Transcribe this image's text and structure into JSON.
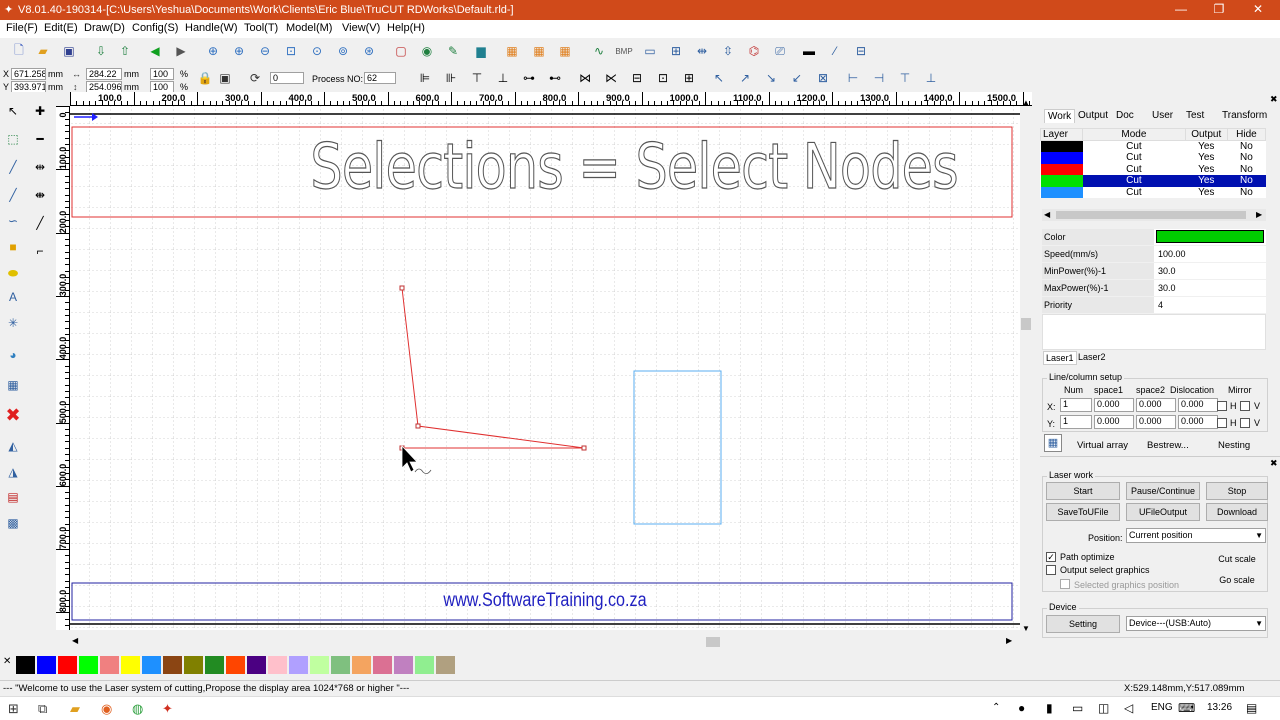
{
  "window": {
    "title": "V8.01.40-190314-[C:\\Users\\Yeshua\\Documents\\Work\\Clients\\Eric Blue\\TruCUT RDWorks\\Default.rld-]",
    "minimize": "—",
    "maximize": "❐",
    "close": "✕"
  },
  "menu": [
    "File(F)",
    "Edit(E)",
    "Draw(D)",
    "Config(S)",
    "Handle(W)",
    "Tool(T)",
    "Model(M)",
    "View(V)",
    "Help(H)"
  ],
  "coords": {
    "x_label": "X",
    "x_value": "671.258",
    "x_unit": "mm",
    "y_label": "Y",
    "y_value": "393.971",
    "y_unit": "mm",
    "w_value": "284.22",
    "w_unit": "mm",
    "h_value": "254.096",
    "h_unit": "mm",
    "sx_value": "100",
    "sy_value": "100",
    "pct1": "%",
    "pct2": "%",
    "rotate_value": "0",
    "process_label": "Process NO:",
    "process_value": "62"
  },
  "ruler": {
    "h_labels": [
      "100.0",
      "200.0",
      "300.0",
      "400.0",
      "500.0",
      "600.0",
      "700.0",
      "800.0",
      "900.0",
      "1000.0",
      "1100.0",
      "1200.0",
      "1300.0",
      "1400.0",
      "1500.0"
    ],
    "v_labels": [
      "0",
      "100.0",
      "200.0",
      "300.0",
      "400.0",
      "500.0",
      "600.0",
      "700.0",
      "800.0"
    ]
  },
  "canvas": {
    "headline": "Selections = Select Nodes",
    "footer_url": "www.SoftwareTraining.co.za"
  },
  "tabs": [
    "Work",
    "Output",
    "Doc",
    "User",
    "Test",
    "Transform"
  ],
  "layers": {
    "headers": [
      "Layer",
      "Mode",
      "Output",
      "Hide"
    ],
    "rows": [
      {
        "color": "#000000",
        "mode": "Cut",
        "output": "Yes",
        "hide": "No",
        "selected": false
      },
      {
        "color": "#0000ff",
        "mode": "Cut",
        "output": "Yes",
        "hide": "No",
        "selected": false
      },
      {
        "color": "#ff0000",
        "mode": "Cut",
        "output": "Yes",
        "hide": "No",
        "selected": false
      },
      {
        "color": "#00e000",
        "mode": "Cut",
        "output": "Yes",
        "hide": "No",
        "selected": true
      },
      {
        "color": "#1e90ff",
        "mode": "Cut",
        "output": "Yes",
        "hide": "No",
        "selected": false
      }
    ]
  },
  "props": {
    "color_label": "Color",
    "color_value": "#00cc00",
    "speed_label": "Speed(mm/s)",
    "speed_value": "100.00",
    "minpower_label": "MinPower(%)-1",
    "minpower_value": "30.0",
    "maxpower_label": "MaxPower(%)-1",
    "maxpower_value": "30.0",
    "priority_label": "Priority",
    "priority_value": "4"
  },
  "laser_tabs": [
    "Laser1",
    "Laser2"
  ],
  "array": {
    "title": "Line/column setup",
    "headers": [
      "Num",
      "space1",
      "space2",
      "Dislocation",
      "Mirror"
    ],
    "x_label": "X:",
    "y_label": "Y:",
    "x_row": [
      "1",
      "0.000",
      "0.000",
      "0.000"
    ],
    "y_row": [
      "1",
      "0.000",
      "0.000",
      "0.000"
    ],
    "h": "H",
    "v": "V",
    "virtual": "Virtual array",
    "bestrew": "Bestrew...",
    "nesting": "Nesting"
  },
  "laserwork": {
    "title": "Laser work",
    "start": "Start",
    "pause": "Pause/Continue",
    "stop": "Stop",
    "save": "SaveToUFile",
    "ufile": "UFileOutput",
    "download": "Download",
    "position_label": "Position:",
    "position_value": "Current position",
    "path_optimize": "Path optimize",
    "output_select": "Output select graphics",
    "selected_pos": "Selected graphics position",
    "cut_scale": "Cut scale",
    "go_scale": "Go scale",
    "device_title": "Device",
    "setting": "Setting",
    "device_value": "Device---(USB:Auto)"
  },
  "palette": [
    "#000000",
    "#0000ff",
    "#ff0000",
    "#00ff00",
    "#f08080",
    "#ffff00",
    "#1e90ff",
    "#8b4513",
    "#808000",
    "#228b22",
    "#ff4500",
    "#4b0082",
    "#ffc0cb",
    "#b0a0ff",
    "#c0ffa0",
    "#7fc07f",
    "#f4a460",
    "#db7093",
    "#c080c0",
    "#90ee90",
    "#b0a080"
  ],
  "status": {
    "message": "--- \"Welcome to use the Laser system of cutting,Propose the display area 1024*768 or higher \"---",
    "coords": "X:529.148mm,Y:517.089mm"
  },
  "taskbar": {
    "lang": "ENG",
    "time": "13:26"
  }
}
